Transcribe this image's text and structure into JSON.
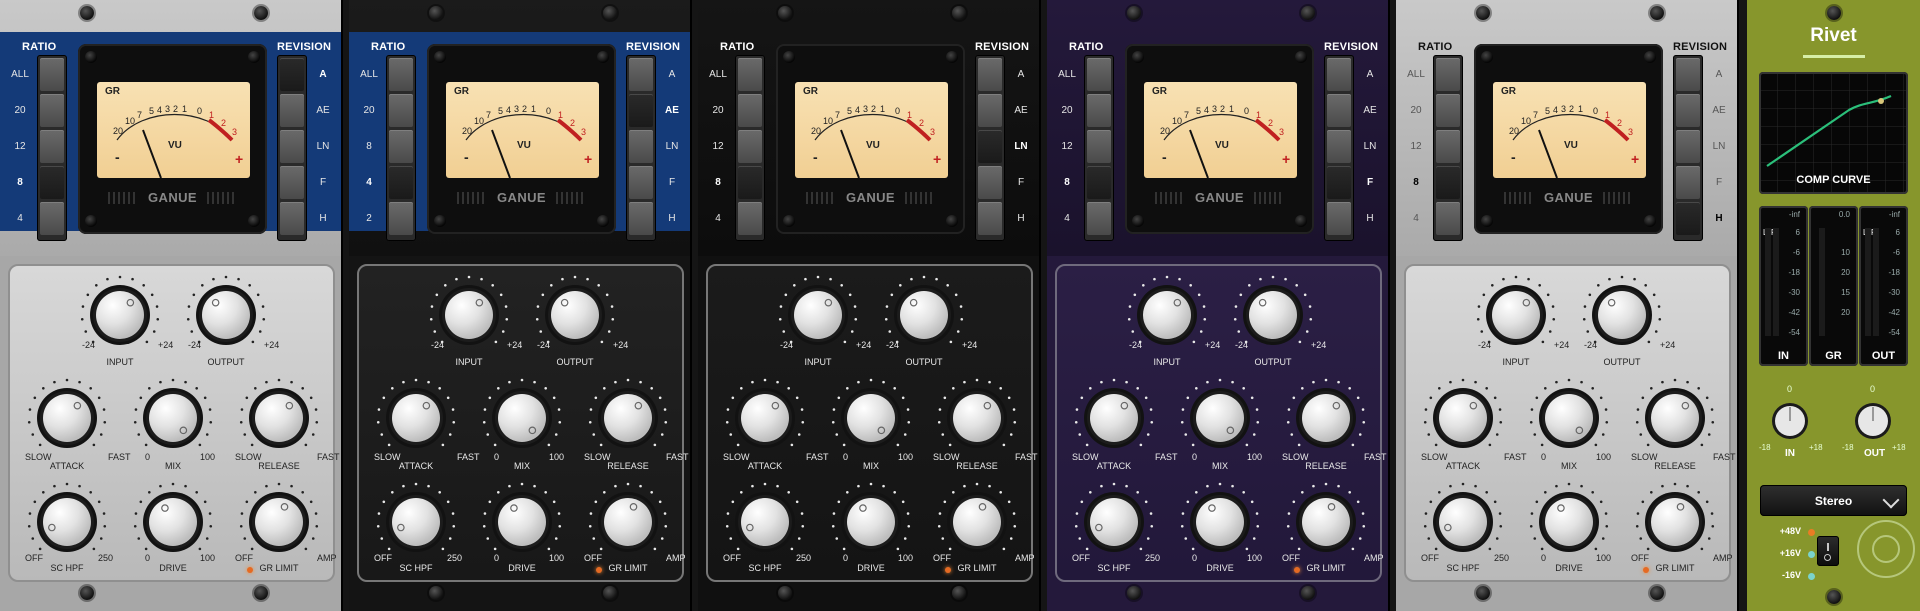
{
  "channels": [
    {
      "theme": "silver",
      "ratio": {
        "title": "RATIO",
        "options": [
          "ALL",
          "20",
          "12",
          "8",
          "4"
        ],
        "selected": "8"
      },
      "revision": {
        "title": "REVISION",
        "options": [
          "A",
          "AE",
          "LN",
          "F",
          "H"
        ],
        "selected": "A"
      },
      "meter": {
        "gr": "GR",
        "vu": "VU",
        "minus": "-",
        "plus": "+",
        "brand": "GANUE",
        "scale": [
          "20",
          "10",
          "7",
          "5",
          "4",
          "3",
          "2",
          "1",
          "0",
          "1",
          "2",
          "3"
        ]
      },
      "knobs": {
        "input": {
          "label": "INPUT",
          "min": "-24",
          "max": "+24"
        },
        "output": {
          "label": "OUTPUT",
          "min": "-24",
          "max": "+24"
        },
        "attack": {
          "label": "ATTACK",
          "min": "SLOW",
          "max": "FAST"
        },
        "mix": {
          "label": "MIX",
          "min": "0",
          "max": "100"
        },
        "release": {
          "label": "RELEASE",
          "min": "SLOW",
          "max": "FAST"
        },
        "schpf": {
          "label": "SC HPF",
          "min": "OFF",
          "max": "250"
        },
        "drive": {
          "label": "DRIVE",
          "min": "0",
          "max": "100"
        },
        "grlimit": {
          "label": "GR LIMIT",
          "min": "OFF",
          "max": "AMP"
        }
      }
    },
    {
      "theme": "blue",
      "ratio": {
        "title": "RATIO",
        "options": [
          "ALL",
          "20",
          "8",
          "4",
          "2"
        ],
        "selected": "4"
      },
      "revision": {
        "title": "REVISION",
        "options": [
          "A",
          "AE",
          "LN",
          "F",
          "H"
        ],
        "selected": "AE"
      },
      "meter": {
        "gr": "GR",
        "vu": "VU",
        "minus": "-",
        "plus": "+",
        "brand": "GANUE",
        "scale": [
          "20",
          "10",
          "7",
          "5",
          "4",
          "3",
          "2",
          "1",
          "0",
          "1",
          "2",
          "3"
        ]
      },
      "knobs": {
        "input": {
          "label": "INPUT",
          "min": "-24",
          "max": "+24"
        },
        "output": {
          "label": "OUTPUT",
          "min": "-24",
          "max": "+24"
        },
        "attack": {
          "label": "ATTACK",
          "min": "SLOW",
          "max": "FAST"
        },
        "mix": {
          "label": "MIX",
          "min": "0",
          "max": "100"
        },
        "release": {
          "label": "RELEASE",
          "min": "SLOW",
          "max": "FAST"
        },
        "schpf": {
          "label": "SC HPF",
          "min": "OFF",
          "max": "250"
        },
        "drive": {
          "label": "DRIVE",
          "min": "0",
          "max": "100"
        },
        "grlimit": {
          "label": "GR LIMIT",
          "min": "OFF",
          "max": "AMP"
        }
      }
    },
    {
      "theme": "black",
      "ratio": {
        "title": "RATIO",
        "options": [
          "ALL",
          "20",
          "12",
          "8",
          "4"
        ],
        "selected": "8"
      },
      "revision": {
        "title": "REVISION",
        "options": [
          "A",
          "AE",
          "LN",
          "F",
          "H"
        ],
        "selected": "LN"
      },
      "meter": {
        "gr": "GR",
        "vu": "VU",
        "minus": "-",
        "plus": "+",
        "brand": "GANUE",
        "scale": [
          "20",
          "10",
          "7",
          "5",
          "4",
          "3",
          "2",
          "1",
          "0",
          "1",
          "2",
          "3"
        ]
      },
      "knobs": {
        "input": {
          "label": "INPUT",
          "min": "-24",
          "max": "+24"
        },
        "output": {
          "label": "OUTPUT",
          "min": "-24",
          "max": "+24"
        },
        "attack": {
          "label": "ATTACK",
          "min": "SLOW",
          "max": "FAST"
        },
        "mix": {
          "label": "MIX",
          "min": "0",
          "max": "100"
        },
        "release": {
          "label": "RELEASE",
          "min": "SLOW",
          "max": "FAST"
        },
        "schpf": {
          "label": "SC HPF",
          "min": "OFF",
          "max": "250"
        },
        "drive": {
          "label": "DRIVE",
          "min": "0",
          "max": "100"
        },
        "grlimit": {
          "label": "GR LIMIT",
          "min": "OFF",
          "max": "AMP"
        }
      }
    },
    {
      "theme": "purple",
      "ratio": {
        "title": "RATIO",
        "options": [
          "ALL",
          "20",
          "12",
          "8",
          "4"
        ],
        "selected": "8"
      },
      "revision": {
        "title": "REVISION",
        "options": [
          "A",
          "AE",
          "LN",
          "F",
          "H"
        ],
        "selected": "F"
      },
      "meter": {
        "gr": "GR",
        "vu": "VU",
        "minus": "-",
        "plus": "+",
        "brand": "GANUE",
        "scale": [
          "20",
          "10",
          "7",
          "5",
          "4",
          "3",
          "2",
          "1",
          "0",
          "1",
          "2",
          "3"
        ]
      },
      "knobs": {
        "input": {
          "label": "INPUT",
          "min": "-24",
          "max": "+24"
        },
        "output": {
          "label": "OUTPUT",
          "min": "-24",
          "max": "+24"
        },
        "attack": {
          "label": "ATTACK",
          "min": "SLOW",
          "max": "FAST"
        },
        "mix": {
          "label": "MIX",
          "min": "0",
          "max": "100"
        },
        "release": {
          "label": "RELEASE",
          "min": "SLOW",
          "max": "FAST"
        },
        "schpf": {
          "label": "SC HPF",
          "min": "OFF",
          "max": "250"
        },
        "drive": {
          "label": "DRIVE",
          "min": "0",
          "max": "100"
        },
        "grlimit": {
          "label": "GR LIMIT",
          "min": "OFF",
          "max": "AMP"
        }
      }
    },
    {
      "theme": "silver",
      "ratio": {
        "title": "RATIO",
        "options": [
          "ALL",
          "20",
          "12",
          "8",
          "4"
        ],
        "selected": "8"
      },
      "revision": {
        "title": "REVISION",
        "options": [
          "A",
          "AE",
          "LN",
          "F",
          "H"
        ],
        "selected": "H"
      },
      "meter": {
        "gr": "GR",
        "vu": "VU",
        "minus": "-",
        "plus": "+",
        "brand": "GANUE",
        "scale": [
          "20",
          "10",
          "7",
          "5",
          "4",
          "3",
          "2",
          "1",
          "0",
          "1",
          "2",
          "3"
        ]
      },
      "knobs": {
        "input": {
          "label": "INPUT",
          "min": "-24",
          "max": "+24"
        },
        "output": {
          "label": "OUTPUT",
          "min": "-24",
          "max": "+24"
        },
        "attack": {
          "label": "ATTACK",
          "min": "SLOW",
          "max": "FAST"
        },
        "mix": {
          "label": "MIX",
          "min": "0",
          "max": "100"
        },
        "release": {
          "label": "RELEASE",
          "min": "SLOW",
          "max": "FAST"
        },
        "schpf": {
          "label": "SC HPF",
          "min": "OFF",
          "max": "250"
        },
        "drive": {
          "label": "DRIVE",
          "min": "0",
          "max": "100"
        },
        "grlimit": {
          "label": "GR LIMIT",
          "min": "OFF",
          "max": "AMP"
        }
      }
    }
  ],
  "rivet": {
    "title": "Rivet",
    "comp_curve_label": "COMP CURVE",
    "meters": [
      {
        "name": "in",
        "caption": "IN",
        "top": "-inf",
        "lr": [
          "L",
          "R"
        ],
        "scale": [
          "6",
          "-6",
          "-18",
          "-30",
          "-42",
          "-54"
        ]
      },
      {
        "name": "gr",
        "caption": "GR",
        "top": "0.0",
        "lr": [],
        "scale": [
          "10",
          "20",
          "15",
          "20"
        ]
      },
      {
        "name": "out",
        "caption": "OUT",
        "top": "-inf",
        "lr": [
          "L",
          "R"
        ],
        "scale": [
          "6",
          "-6",
          "-18",
          "-30",
          "-42",
          "-54"
        ]
      }
    ],
    "knobs": [
      {
        "name": "in",
        "label": "IN",
        "min": "-18",
        "max": "+18",
        "center": "0"
      },
      {
        "name": "out",
        "label": "OUT",
        "min": "-18",
        "max": "+18",
        "center": "0"
      }
    ],
    "mode": "Stereo",
    "voltages": [
      {
        "label": "+48V",
        "color": "#ea7c24"
      },
      {
        "label": "+16V",
        "color": "#7bd3cc"
      },
      {
        "label": "-16V",
        "color": "#7bd3cc"
      }
    ]
  }
}
